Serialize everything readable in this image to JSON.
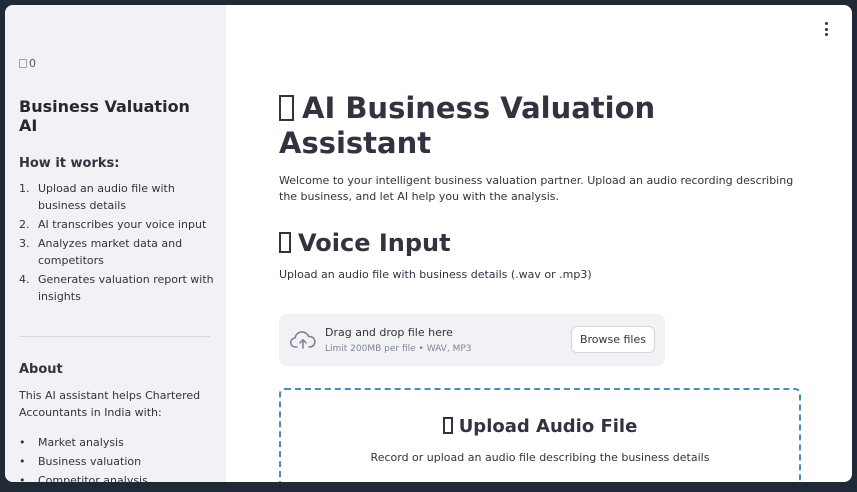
{
  "sidebar": {
    "logo_alt": "0",
    "title": "Business Valuation AI",
    "how_heading": "How it works:",
    "steps": [
      {
        "num": "1.",
        "text": "Upload an audio file with business details"
      },
      {
        "num": "2.",
        "text": "AI transcribes your voice input"
      },
      {
        "num": "3.",
        "text": "Analyzes market data and competitors"
      },
      {
        "num": "4.",
        "text": "Generates valuation report with insights"
      }
    ],
    "about_heading": "About",
    "about_text": "This AI assistant helps Chartered Accountants in India with:",
    "about_items": [
      "Market analysis",
      "Business valuation",
      "Competitor analysis"
    ]
  },
  "main": {
    "title": "AI Business Valuation Assistant",
    "intro": "Welcome to your intelligent business valuation partner. Upload an audio recording describing the business, and let AI help you with the analysis.",
    "voice_heading": "Voice Input",
    "upload_note": "Upload an audio file with business details (.wav or .mp3)",
    "dropzone": {
      "title": "Drag and drop file here",
      "limit": "Limit 200MB per file • WAV, MP3",
      "browse_label": "Browse files"
    },
    "upload_card": {
      "title": "Upload Audio File",
      "subtitle": "Record or upload an audio file describing the business details"
    }
  },
  "icons": {
    "menu": "kebab-menu-icon",
    "upload": "cloud-upload-icon",
    "missing_emoji": "missing-glyph-icon"
  }
}
